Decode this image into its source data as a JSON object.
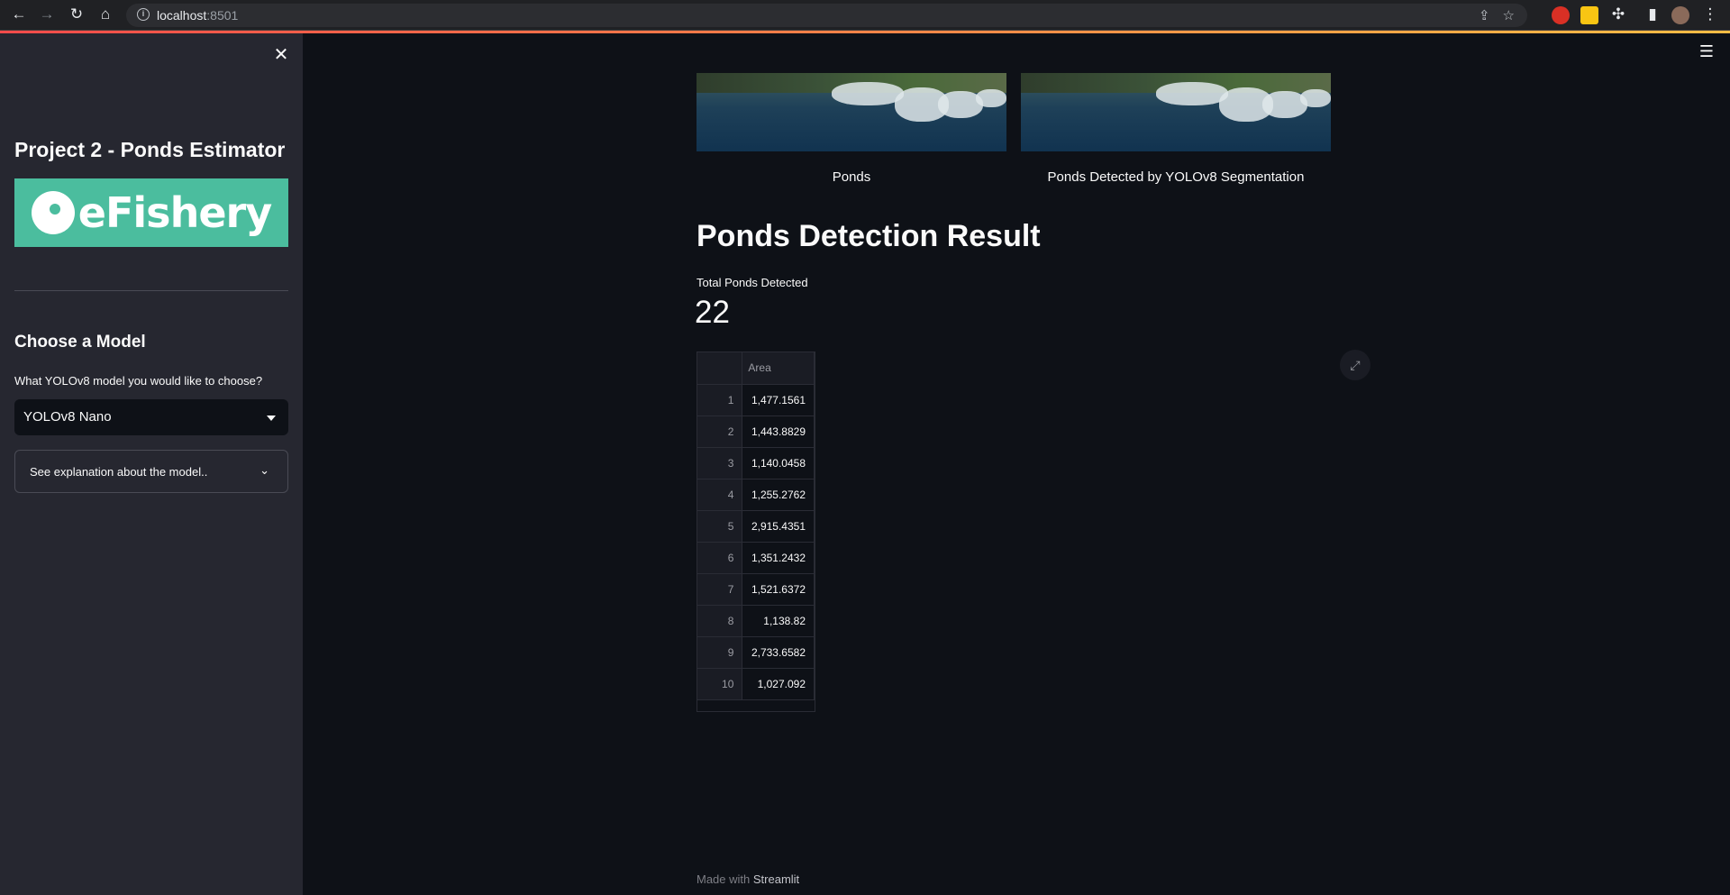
{
  "browser": {
    "url_host": "localhost",
    "url_port": ":8501"
  },
  "sidebar": {
    "title": "Project 2 - Ponds Estimator",
    "logo_text": "eFishery",
    "model_heading": "Choose a Model",
    "model_question": "What YOLOv8 model you would like to choose?",
    "model_selected": "YOLOv8 Nano",
    "expander_label": "See explanation about the model.."
  },
  "main": {
    "image_captions": [
      "Ponds",
      "Ponds Detected by YOLOv8 Segmentation"
    ],
    "result_heading": "Ponds Detection Result",
    "metric_label": "Total Ponds Detected",
    "metric_value": "22",
    "table": {
      "column": "Area",
      "rows": [
        {
          "index": "1",
          "area": "1,477.1561"
        },
        {
          "index": "2",
          "area": "1,443.8829"
        },
        {
          "index": "3",
          "area": "1,140.0458"
        },
        {
          "index": "4",
          "area": "1,255.2762"
        },
        {
          "index": "5",
          "area": "2,915.4351"
        },
        {
          "index": "6",
          "area": "1,351.2432"
        },
        {
          "index": "7",
          "area": "1,521.6372"
        },
        {
          "index": "8",
          "area": "1,138.82"
        },
        {
          "index": "9",
          "area": "2,733.6582"
        },
        {
          "index": "10",
          "area": "1,027.092"
        }
      ]
    },
    "footer_prefix": "Made with",
    "footer_brand": "Streamlit"
  },
  "colors": {
    "background": "#0e1117",
    "sidebar": "#262730",
    "logo": "#4bbd9e",
    "accent": "#ff4b4b"
  },
  "icons": [
    "back-icon",
    "forward-icon",
    "reload-icon",
    "home-icon",
    "info-icon",
    "share-icon",
    "star-icon",
    "puzzle-icon",
    "sidepanel-icon",
    "kebab-icon",
    "close-icon",
    "hamburger-icon",
    "chevron-down-icon",
    "fullscreen-icon"
  ]
}
